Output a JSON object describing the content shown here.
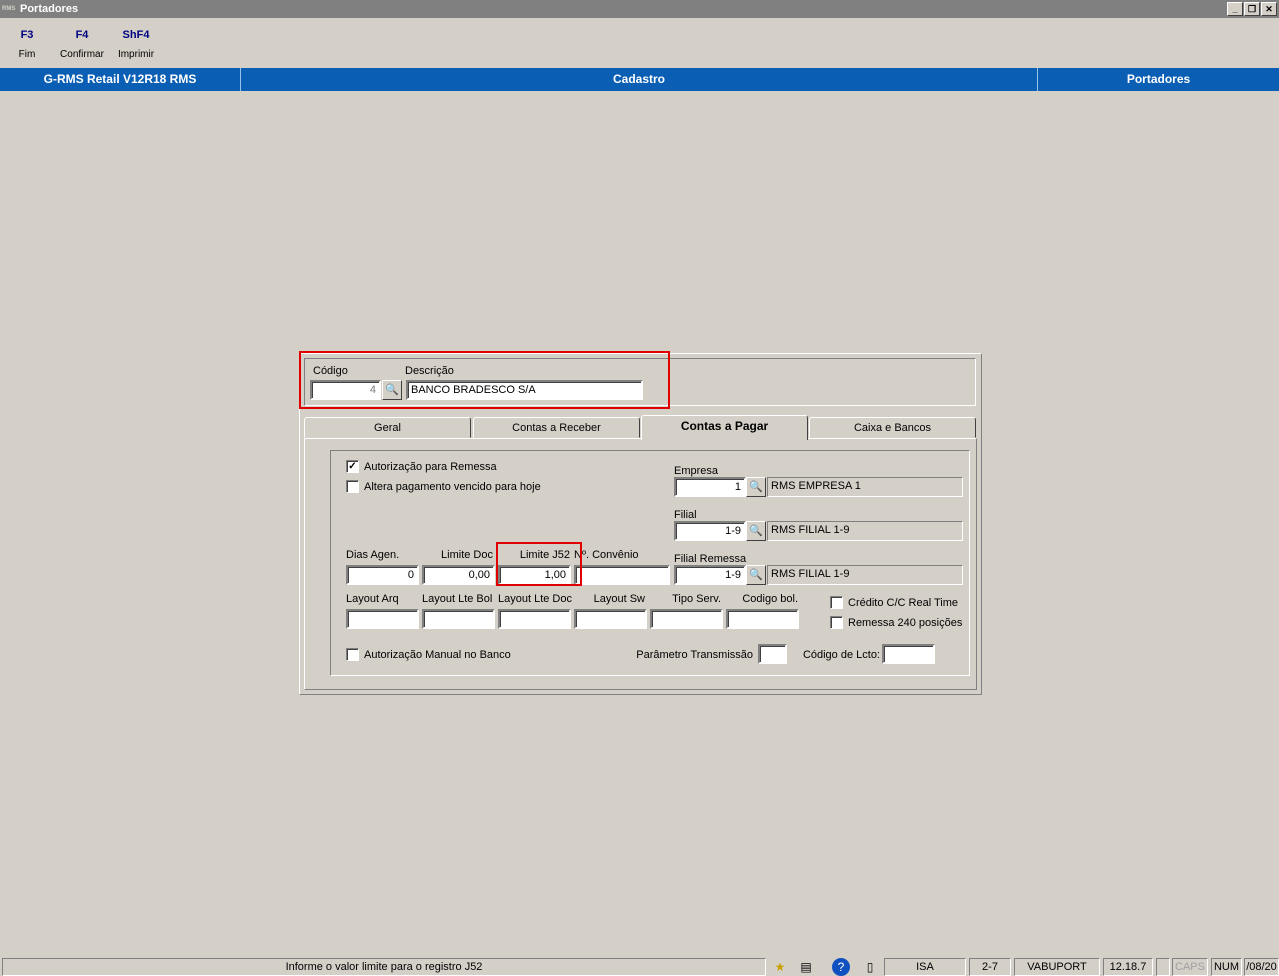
{
  "window": {
    "title": "Portadores",
    "icon_text": "RMS",
    "buttons": {
      "minimize": "_",
      "restore": "❐",
      "close": "✕"
    }
  },
  "toolbar": [
    {
      "key": "F3",
      "label": "Fim"
    },
    {
      "key": "F4",
      "label": "Confirmar"
    },
    {
      "key": "ShF4",
      "label": "Imprimir"
    }
  ],
  "header": {
    "system": "G-RMS Retail V12R18 RMS",
    "module": "Cadastro",
    "screen": "Portadores"
  },
  "record": {
    "codigo_label": "Código",
    "codigo_value": "4",
    "descricao_label": "Descrição",
    "descricao_value": "BANCO BRADESCO S/A"
  },
  "tabs": [
    {
      "label": "Geral"
    },
    {
      "label": "Contas a Receber"
    },
    {
      "label": "Contas a Pagar",
      "active": true
    },
    {
      "label": "Caixa e Bancos"
    }
  ],
  "contas_pagar": {
    "autorizacao_remessa": {
      "label": "Autorização para Remessa",
      "checked": true,
      "mark": "✓"
    },
    "altera_pagamento": {
      "label": "Altera pagamento vencido para hoje",
      "checked": false
    },
    "empresa": {
      "label": "Empresa",
      "value": "1",
      "desc": "RMS EMPRESA 1"
    },
    "filial": {
      "label": "Filial",
      "value": "1-9",
      "desc": "RMS FILIAL 1-9"
    },
    "filial_remessa": {
      "label": "Filial Remessa",
      "value": "1-9",
      "desc": "RMS FILIAL 1-9"
    },
    "dias_agen": {
      "label": "Dias Agen.",
      "value": "0"
    },
    "limite_doc": {
      "label": "Limite Doc",
      "value": "0,00"
    },
    "limite_j52": {
      "label": "Limite J52",
      "value": "1,00"
    },
    "convenio": {
      "label": "Nº. Convênio",
      "value": ""
    },
    "layout_arq": {
      "label": "Layout Arq",
      "value": ""
    },
    "layout_lte_bol": {
      "label": "Layout Lte Bol",
      "value": ""
    },
    "layout_lte_doc": {
      "label": "Layout Lte Doc",
      "value": ""
    },
    "layout_sw": {
      "label": "Layout Sw",
      "value": ""
    },
    "tipo_serv": {
      "label": "Tipo Serv.",
      "value": ""
    },
    "codigo_bol": {
      "label": "Codigo bol.",
      "value": ""
    },
    "credito_cc": {
      "label": "Crédito C/C Real Time",
      "checked": false
    },
    "remessa_240": {
      "label": "Remessa 240 posições",
      "checked": false
    },
    "autorizacao_manual": {
      "label": "Autorização Manual no Banco",
      "checked": false
    },
    "parametro_transmissao": {
      "label": "Parâmetro Transmissão",
      "value": ""
    },
    "codigo_lcto": {
      "label": "Código de Lcto:",
      "value": ""
    }
  },
  "statusbar": {
    "message": "Informe o valor limite para o registro J52",
    "icons": [
      "star-icon",
      "clipboard-user-icon",
      "help-icon",
      "notepad-icon"
    ],
    "cells": [
      "ISA",
      "2-7",
      "VABUPORT",
      "12.18.7",
      "",
      "CAPS",
      "NUM",
      "/08/20"
    ]
  }
}
